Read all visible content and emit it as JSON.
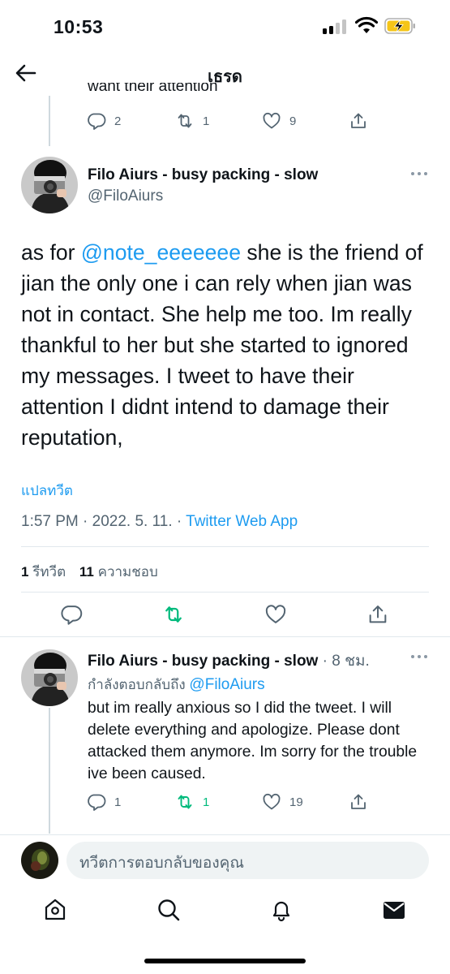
{
  "status_bar": {
    "time": "10:53"
  },
  "header": {
    "title": "เธรด"
  },
  "previous_tweet": {
    "fragment_text": "want their attention",
    "actions": {
      "reply_count": "2",
      "retweet_count": "1",
      "like_count": "9"
    }
  },
  "main_tweet": {
    "author_name": "Filo Aiurs - busy packing - slow",
    "handle": "@FiloAiurs",
    "text_before_mention": "as for ",
    "mention": "@note_eeeeeee",
    "text_after_mention": "  she is the friend of jian the only one i can rely when jian was not in contact. She help me too. Im really thankful to her but she started to ignored my messages. I tweet to have their attention I didnt intend to damage their reputation,",
    "translate_label": "แปลทวีต",
    "timestamp": "1:57 PM · 2022. 5. 11. · ",
    "source": "Twitter Web App",
    "retweet_count": "1",
    "retweet_label": "รีทวีต",
    "like_count": "11",
    "like_label": "ความชอบ"
  },
  "reply_tweet": {
    "author_name": "Filo Aiurs - busy packing - slow",
    "time_ago": " · 8 ชม.",
    "replying_to_label": "กำลังตอบกลับถึง ",
    "replying_to_handle": "@FiloAiurs",
    "text": "but im really anxious so I did the tweet. I will delete everything and apologize. Please dont attacked them anymore. Im sorry for the trouble ive been caused.",
    "actions": {
      "reply_count": "1",
      "retweet_count": "1",
      "like_count": "19"
    }
  },
  "composer": {
    "placeholder": "ทวีตการตอบกลับของคุณ"
  },
  "colors": {
    "accent": "#1d9bf0",
    "retweet_green": "#00ba7c",
    "secondary_text": "#536471"
  }
}
